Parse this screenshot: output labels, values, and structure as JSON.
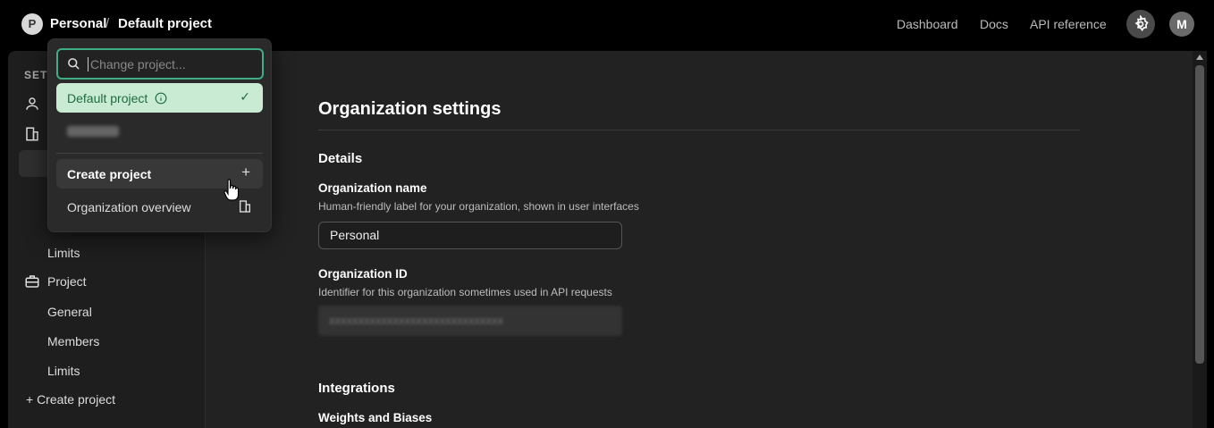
{
  "topbar": {
    "org_initial": "P",
    "org_name": "Personal",
    "separator": "/",
    "project_name": "Default project",
    "links": [
      "Dashboard",
      "Docs",
      "API reference"
    ],
    "user_initial": "M"
  },
  "sidebar": {
    "heading": "SET",
    "project_section": "Project",
    "org_limits": "Limits",
    "project_items": [
      "General",
      "Members",
      "Limits"
    ],
    "create_project": "+ Create project"
  },
  "main": {
    "title": "Organization settings",
    "details_heading": "Details",
    "org_name_label": "Organization name",
    "org_name_help": "Human-friendly label for your organization, shown in user interfaces",
    "org_name_value": "Personal",
    "org_id_label": "Organization ID",
    "org_id_help": "Identifier for this organization sometimes used in API requests",
    "integrations_heading": "Integrations",
    "wandb_label": "Weights and Biases"
  },
  "dropdown": {
    "search_placeholder": "Change project...",
    "selected_project": "Default project",
    "create_label": "Create project",
    "overview_label": "Organization overview"
  },
  "colors": {
    "accent_green": "#3fae84",
    "selected_bg": "#c9ebd4",
    "selected_text": "#1f6b3e"
  }
}
